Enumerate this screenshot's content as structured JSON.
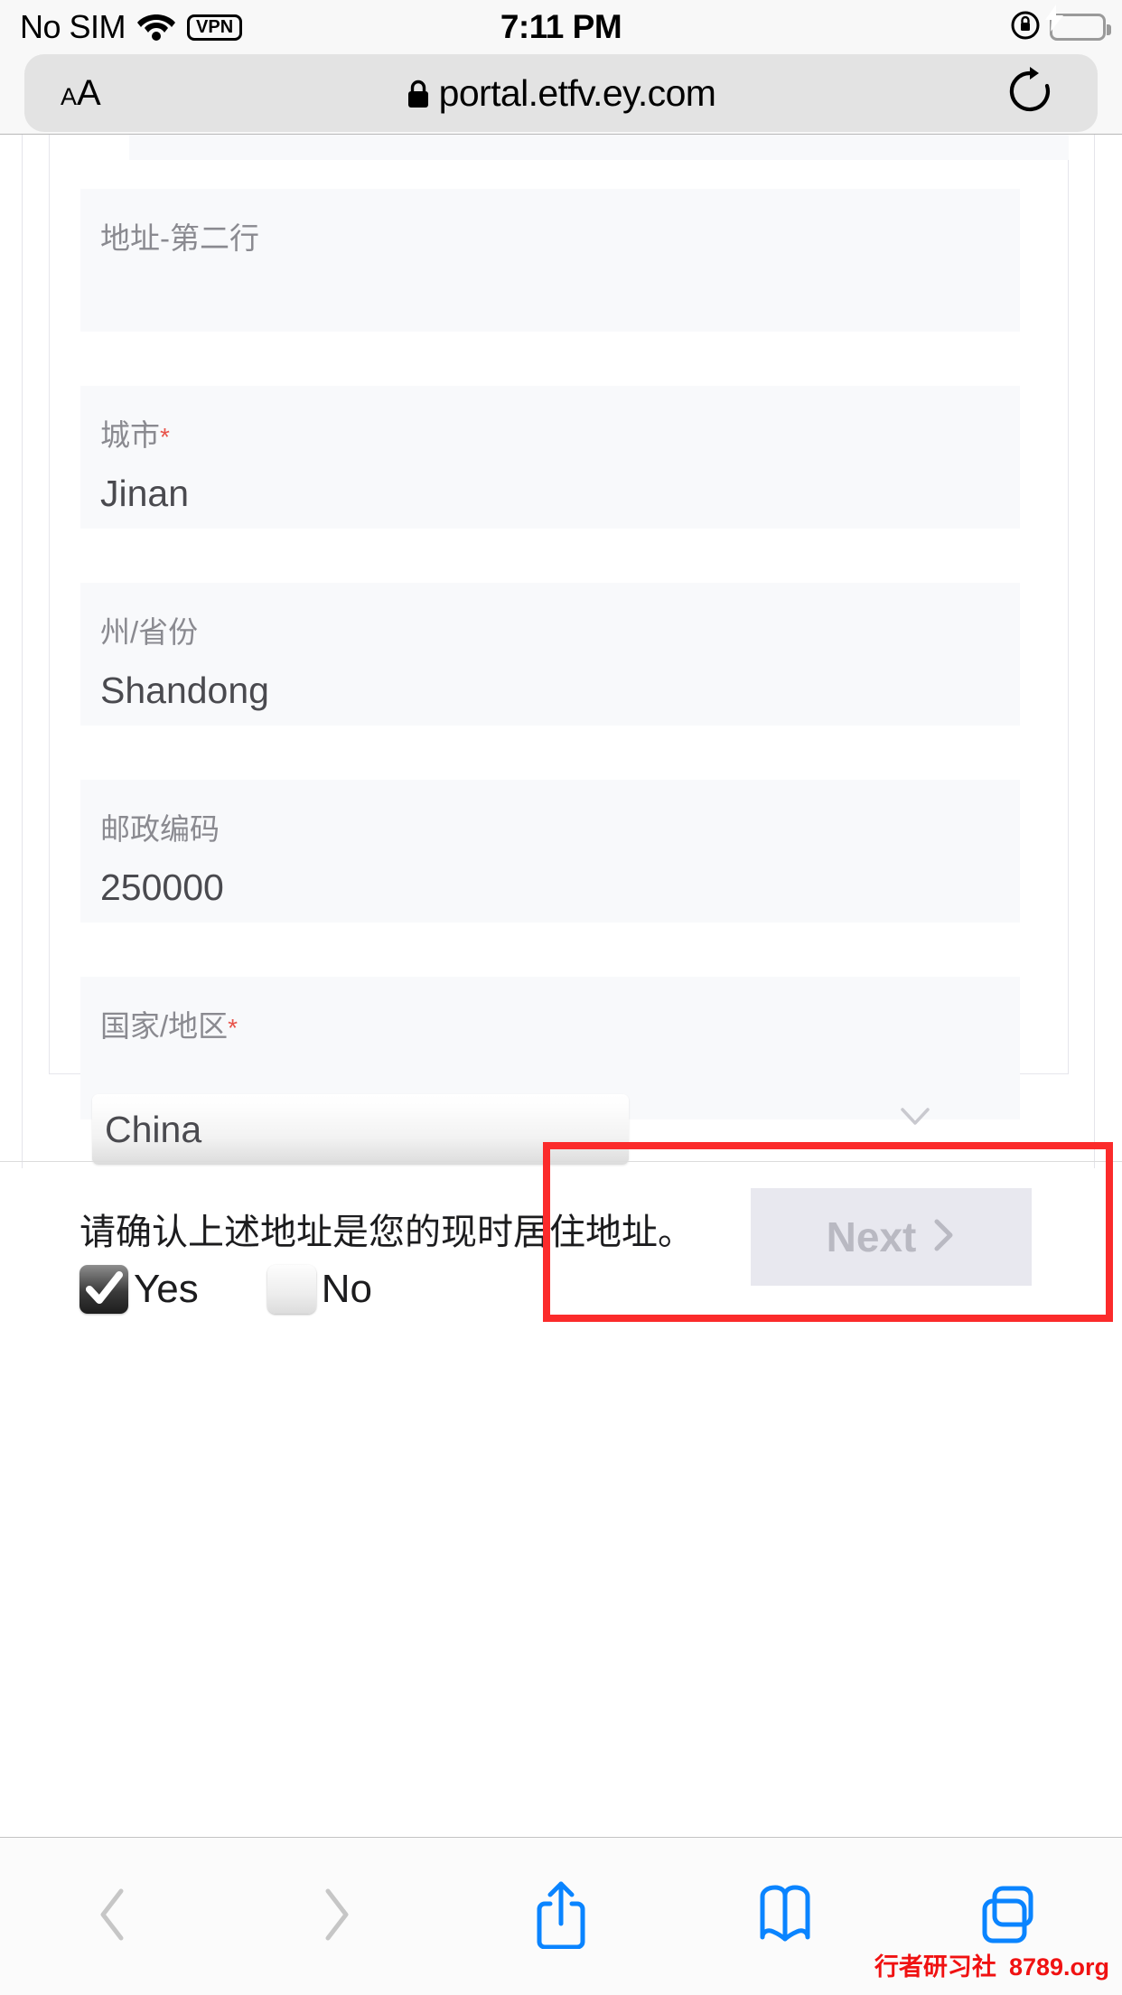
{
  "status_bar": {
    "carrier": "No SIM",
    "wifi_icon": "wifi-icon",
    "vpn_badge": "VPN",
    "time": "7:11 PM",
    "rotation_lock_icon": "rotation-lock-icon",
    "battery_icon": "battery-charging-icon"
  },
  "browser": {
    "text_size_small": "A",
    "text_size_large": "A",
    "lock_icon": "lock-icon",
    "url": "portal.etfv.ey.com",
    "reload_icon": "reload-icon"
  },
  "form": {
    "fields": [
      {
        "label": "地址-第二行",
        "required": false,
        "value": ""
      },
      {
        "label": "城市",
        "required": true,
        "value": "Jinan"
      },
      {
        "label": "州/省份",
        "required": false,
        "value": "Shandong"
      },
      {
        "label": "邮政编码",
        "required": false,
        "value": "250000"
      },
      {
        "label": "国家/地区",
        "required": true,
        "value": "China"
      }
    ],
    "required_marker": "*",
    "country_selected": "China",
    "chevron_icon": "chevron-down-icon",
    "confirm_question": "请确认上述地址是您的现时居住地址。",
    "choices": [
      {
        "label": "Yes",
        "checked": true
      },
      {
        "label": "No",
        "checked": false
      }
    ]
  },
  "footer": {
    "next_label": "Next",
    "next_arrow_icon": "chevron-right-icon",
    "next_disabled": true,
    "highlight_color": "#fb2b2b"
  },
  "toolbar": {
    "back_icon": "chevron-left-icon",
    "forward_icon": "chevron-right-icon",
    "share_icon": "share-icon",
    "bookmarks_icon": "book-icon",
    "tabs_icon": "tabs-icon"
  },
  "watermark": {
    "cn": "行者研习社",
    "site": "8789.org"
  }
}
